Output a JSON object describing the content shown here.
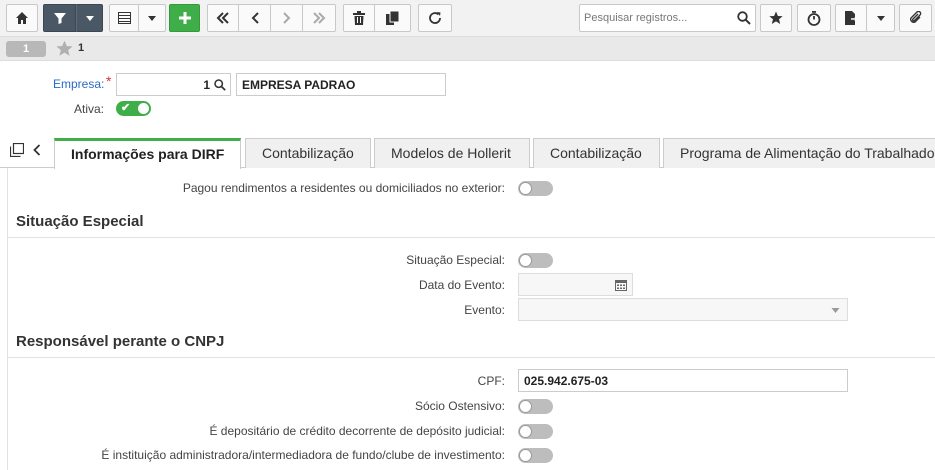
{
  "toolbar": {
    "icons": [
      "home-icon",
      "filter-icon",
      "caret-down-icon",
      "grid-icon",
      "caret-down-icon",
      "add-icon",
      "first-icon",
      "prev-icon",
      "next-icon",
      "last-icon",
      "delete-icon",
      "copy-icon",
      "refresh-icon",
      "search-icon",
      "star-icon",
      "timer-icon",
      "export-icon",
      "caret-down-icon",
      "attach-icon"
    ],
    "search_placeholder": "Pesquisar registros..."
  },
  "record_bar": {
    "record_number": "1",
    "favorites_count": "1"
  },
  "header": {
    "empresa_label": "Empresa:",
    "required_mark": "*",
    "empresa_code": "1",
    "empresa_name": "EMPRESA PADRAO",
    "ativa_label": "Ativa:",
    "ativa_on": true
  },
  "tabs": [
    {
      "label": "Informações para DIRF",
      "active": true
    },
    {
      "label": "Contabilização",
      "active": false
    },
    {
      "label": "Modelos de Hollerit",
      "active": false
    },
    {
      "label": "Contabilização",
      "active": false
    },
    {
      "label": "Programa de Alimentação do Trabalhador",
      "active": false
    }
  ],
  "form": {
    "exterior_label": "Pagou rendimentos a residentes ou domiciliados no exterior:",
    "situacao_title": "Situação Especial",
    "situacao_label": "Situação Especial:",
    "data_evento_label": "Data do Evento:",
    "data_evento_value": "",
    "evento_label": "Evento:",
    "evento_value": "",
    "responsavel_title": "Responsável perante o CNPJ",
    "cpf_label": "CPF:",
    "cpf_value": "025.942.675-03",
    "socio_label": "Sócio Ostensivo:",
    "depositario_label": "É depositário de crédito decorrente de depósito judicial:",
    "instituicao_label": "É instituição administradora/intermediadora de fundo/clube de investimento:"
  },
  "colors": {
    "accent_green": "#3fae49",
    "toolbar_dark": "#4a5866",
    "link_blue": "#2a6bc7"
  }
}
